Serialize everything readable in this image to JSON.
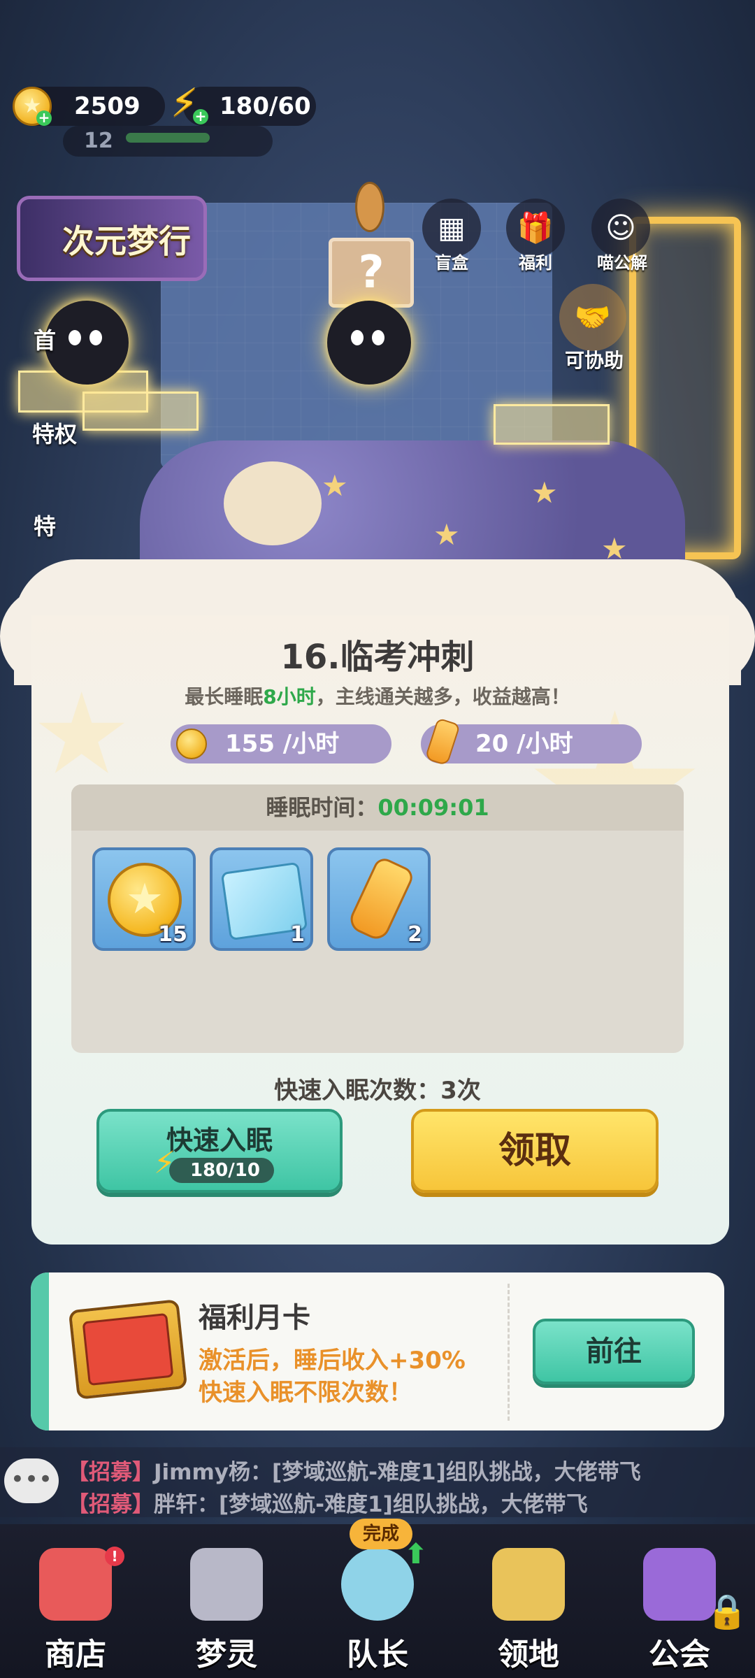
{
  "hud": {
    "coins": "2509",
    "energy": "180/60",
    "level": "12"
  },
  "event_banner": {
    "label": "次元梦行"
  },
  "top_icons": [
    {
      "label": "盲盒",
      "icon": "blind-box-icon"
    },
    {
      "label": "福利",
      "icon": "gift-icon"
    },
    {
      "label": "喵公解",
      "icon": "cat-icon"
    }
  ],
  "right_icons": [
    {
      "label": "可协助",
      "icon": "handshake-icon"
    }
  ],
  "side_labels": [
    "首",
    "特权",
    "特"
  ],
  "sleep_panel": {
    "title": "16.临考冲刺",
    "subtitle_prefix": "最长睡眠",
    "subtitle_hours": "8小时",
    "subtitle_suffix": "，主线通关越多，收益越高！",
    "coin_rate": "155 /小时",
    "bottle_rate": "20 /小时",
    "sleep_time_label": "睡眠时间：",
    "sleep_time_value": "00:09:01",
    "rewards": [
      {
        "name": "coin",
        "count": "15"
      },
      {
        "name": "map",
        "count": "1"
      },
      {
        "name": "bottle",
        "count": "2"
      }
    ],
    "quick_sleep_count": "快速入眠次数：3次",
    "quick_sleep_button": "快速入眠",
    "quick_sleep_cost": "180/10",
    "claim_button": "领取"
  },
  "monthly_card": {
    "title": "福利月卡",
    "line1": "激活后，睡后收入+30%",
    "line2": "快速入眠不限次数！",
    "go_button": "前往"
  },
  "chat": [
    {
      "tag": "【招募】",
      "text": "Jimmy杨：[梦域巡航-难度1]组队挑战，大佬带飞"
    },
    {
      "tag": "【招募】",
      "text": "胖轩：[梦域巡航-难度1]组队挑战，大佬带飞"
    }
  ],
  "bottom_nav": [
    {
      "label": "商店",
      "icon": "shop-icon",
      "color": "#e85a5a"
    },
    {
      "label": "梦灵",
      "icon": "robot-icon",
      "color": "#b8b8c8"
    },
    {
      "label": "队长",
      "icon": "avatar-icon",
      "color": "#8fd3e8"
    },
    {
      "label": "领地",
      "icon": "door-icon",
      "color": "#e9c35a"
    },
    {
      "label": "公会",
      "icon": "guild-icon",
      "color": "#9a6ad8"
    }
  ],
  "complete_tag": "完成",
  "colors": {
    "accent_green": "#2ea84a",
    "button_teal": "#3fc5a4",
    "button_yellow": "#f7c53a",
    "card_orange": "#e9912a"
  }
}
